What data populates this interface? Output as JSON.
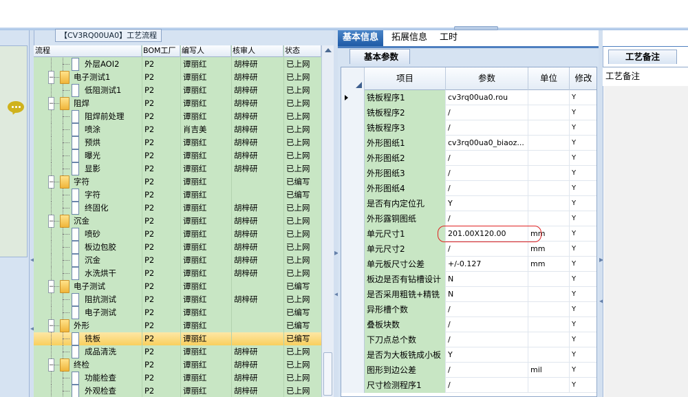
{
  "flow_panel": {
    "title": "【CV3RQ00UA0】工艺流程",
    "columns": [
      "流程",
      "BOM工厂",
      "编写人",
      "核审人",
      "状态"
    ],
    "rows": [
      {
        "level": 2,
        "kind": "doc",
        "name": "外层AOI2",
        "bom": "P2",
        "writer": "谭丽红",
        "reviewer": "胡梓研",
        "status": "已上网"
      },
      {
        "level": 1,
        "kind": "folder",
        "name": "电子测试1",
        "bom": "P2",
        "writer": "谭丽红",
        "reviewer": "胡梓研",
        "status": "已上网"
      },
      {
        "level": 2,
        "kind": "doc",
        "name": "低阻测试1",
        "bom": "P2",
        "writer": "谭丽红",
        "reviewer": "胡梓研",
        "status": "已上网"
      },
      {
        "level": 1,
        "kind": "folder",
        "name": "阻焊",
        "bom": "P2",
        "writer": "谭丽红",
        "reviewer": "胡梓研",
        "status": "已上网"
      },
      {
        "level": 2,
        "kind": "doc",
        "name": "阻焊前处理",
        "bom": "P2",
        "writer": "谭丽红",
        "reviewer": "胡梓研",
        "status": "已上网"
      },
      {
        "level": 2,
        "kind": "doc",
        "name": "喷涂",
        "bom": "P2",
        "writer": "肖吉美",
        "reviewer": "胡梓研",
        "status": "已上网"
      },
      {
        "level": 2,
        "kind": "doc",
        "name": "预烘",
        "bom": "P2",
        "writer": "谭丽红",
        "reviewer": "胡梓研",
        "status": "已上网"
      },
      {
        "level": 2,
        "kind": "doc",
        "name": "曝光",
        "bom": "P2",
        "writer": "谭丽红",
        "reviewer": "胡梓研",
        "status": "已上网"
      },
      {
        "level": 2,
        "kind": "doc",
        "name": "显影",
        "bom": "P2",
        "writer": "谭丽红",
        "reviewer": "胡梓研",
        "status": "已上网"
      },
      {
        "level": 1,
        "kind": "folder",
        "name": "字符",
        "bom": "P2",
        "writer": "谭丽红",
        "reviewer": "",
        "status": "已编写"
      },
      {
        "level": 2,
        "kind": "doc",
        "name": "字符",
        "bom": "P2",
        "writer": "谭丽红",
        "reviewer": "",
        "status": "已编写"
      },
      {
        "level": 2,
        "kind": "doc",
        "name": "终固化",
        "bom": "P2",
        "writer": "谭丽红",
        "reviewer": "胡梓研",
        "status": "已上网"
      },
      {
        "level": 1,
        "kind": "folder",
        "name": "沉金",
        "bom": "P2",
        "writer": "谭丽红",
        "reviewer": "胡梓研",
        "status": "已上网"
      },
      {
        "level": 2,
        "kind": "doc",
        "name": "喷砂",
        "bom": "P2",
        "writer": "谭丽红",
        "reviewer": "胡梓研",
        "status": "已上网"
      },
      {
        "level": 2,
        "kind": "doc",
        "name": "板边包胶",
        "bom": "P2",
        "writer": "谭丽红",
        "reviewer": "胡梓研",
        "status": "已上网"
      },
      {
        "level": 2,
        "kind": "doc",
        "name": "沉金",
        "bom": "P2",
        "writer": "谭丽红",
        "reviewer": "胡梓研",
        "status": "已上网"
      },
      {
        "level": 2,
        "kind": "doc",
        "name": "水洗烘干",
        "bom": "P2",
        "writer": "谭丽红",
        "reviewer": "胡梓研",
        "status": "已上网"
      },
      {
        "level": 1,
        "kind": "folder",
        "name": "电子测试",
        "bom": "P2",
        "writer": "谭丽红",
        "reviewer": "",
        "status": "已编写"
      },
      {
        "level": 2,
        "kind": "doc",
        "name": "阻抗测试",
        "bom": "P2",
        "writer": "谭丽红",
        "reviewer": "胡梓研",
        "status": "已上网"
      },
      {
        "level": 2,
        "kind": "doc",
        "name": "电子测试",
        "bom": "P2",
        "writer": "谭丽红",
        "reviewer": "",
        "status": "已编写"
      },
      {
        "level": 1,
        "kind": "folder",
        "name": "外形",
        "bom": "P2",
        "writer": "谭丽红",
        "reviewer": "",
        "status": "已编写"
      },
      {
        "level": 2,
        "kind": "doc",
        "name": "铣板",
        "bom": "P2",
        "writer": "谭丽红",
        "reviewer": "",
        "status": "已编写",
        "selected": true
      },
      {
        "level": 2,
        "kind": "doc",
        "name": "成品清洗",
        "bom": "P2",
        "writer": "谭丽红",
        "reviewer": "胡梓研",
        "status": "已上网"
      },
      {
        "level": 1,
        "kind": "folder",
        "name": "终检",
        "bom": "P2",
        "writer": "谭丽红",
        "reviewer": "胡梓研",
        "status": "已上网"
      },
      {
        "level": 2,
        "kind": "doc",
        "name": "功能检查",
        "bom": "P2",
        "writer": "谭丽红",
        "reviewer": "胡梓研",
        "status": "已上网"
      },
      {
        "level": 2,
        "kind": "doc",
        "name": "外观检查",
        "bom": "P2",
        "writer": "谭丽红",
        "reviewer": "胡梓研",
        "status": "已上网"
      }
    ]
  },
  "tabs": [
    "基本信息",
    "拓展信息",
    "工时"
  ],
  "active_tab": "基本信息",
  "sub_tab": "基本参数",
  "param_table": {
    "columns": [
      "项目",
      "参数",
      "单位",
      "修改"
    ],
    "rows": [
      {
        "item": "铣板程序1",
        "param": "cv3rq00ua0.rou",
        "unit": "",
        "mod": "Y",
        "current": true
      },
      {
        "item": "铣板程序2",
        "param": "/",
        "unit": "",
        "mod": "Y"
      },
      {
        "item": "铣板程序3",
        "param": "/",
        "unit": "",
        "mod": "Y"
      },
      {
        "item": "外形图纸1",
        "param": "cv3rq00ua0_biaoz...",
        "unit": "",
        "mod": "Y"
      },
      {
        "item": "外形图纸2",
        "param": "/",
        "unit": "",
        "mod": "Y"
      },
      {
        "item": "外形图纸3",
        "param": "/",
        "unit": "",
        "mod": "Y"
      },
      {
        "item": "外形图纸4",
        "param": "/",
        "unit": "",
        "mod": "Y"
      },
      {
        "item": "是否有内定位孔",
        "param": "Y",
        "unit": "",
        "mod": "Y"
      },
      {
        "item": "外形露铜图纸",
        "param": "/",
        "unit": "",
        "mod": "Y"
      },
      {
        "item": "单元尺寸1",
        "param": "201.00X120.00",
        "unit": "mm",
        "mod": "Y",
        "annotated": true
      },
      {
        "item": "单元尺寸2",
        "param": "/",
        "unit": "mm",
        "mod": "Y"
      },
      {
        "item": "单元板尺寸公差",
        "param": "+/-0.127",
        "unit": "mm",
        "mod": "Y"
      },
      {
        "item": "板边是否有钻槽设计",
        "param": "N",
        "unit": "",
        "mod": "Y"
      },
      {
        "item": "是否采用粗铣+精铣",
        "param": "N",
        "unit": "",
        "mod": "Y"
      },
      {
        "item": "异形槽个数",
        "param": "/",
        "unit": "",
        "mod": "Y"
      },
      {
        "item": "叠板块数",
        "param": "/",
        "unit": "",
        "mod": "Y"
      },
      {
        "item": "下刀点总个数",
        "param": "/",
        "unit": "",
        "mod": "Y"
      },
      {
        "item": "是否为大板铣成小板",
        "param": "Y",
        "unit": "",
        "mod": "Y"
      },
      {
        "item": "图形到边公差",
        "param": "/",
        "unit": "mil",
        "mod": "Y"
      },
      {
        "item": "尺寸检测程序1",
        "param": "/",
        "unit": "",
        "mod": "Y"
      }
    ]
  },
  "notes": {
    "tab": "工艺备注",
    "header": "工艺备注"
  },
  "icons": {
    "chat": "chat-bubble-icon",
    "folder": "folder-icon",
    "doc": "document-icon"
  },
  "colors": {
    "grid_bg": "#c8e6c4",
    "selected_row": "#f9cf5d",
    "active_tab": "#1e5aa6",
    "annotation": "#e02020"
  }
}
